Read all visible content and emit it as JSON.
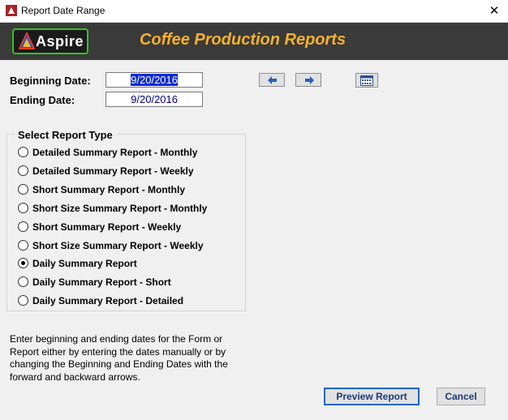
{
  "window": {
    "title": "Report Date Range",
    "close_glyph": "✕"
  },
  "banner": {
    "logo_text": "Aspire",
    "title": "Coffee Production Reports"
  },
  "dates": {
    "beginning_label": "Beginning Date:",
    "beginning_value": "9/20/2016",
    "ending_label": "Ending Date:",
    "ending_value": "9/20/2016"
  },
  "nav": {
    "back_icon": "arrow-left-icon",
    "forward_icon": "arrow-right-icon",
    "calendar_icon": "calendar-icon"
  },
  "report_type": {
    "group_title": "Select Report Type",
    "selected_index": 6,
    "options": [
      "Detailed Summary Report - Monthly",
      "Detailed Summary Report - Weekly",
      "Short Summary Report - Monthly",
      "Short Size Summary Report - Monthly",
      "Short Summary Report - Weekly",
      "Short Size Summary Report - Weekly",
      "Daily Summary Report",
      "Daily Summary Report - Short",
      "Daily Summary Report - Detailed"
    ]
  },
  "instructions": "Enter beginning and ending dates for the Form or Report either by entering the dates manually or by changing the Beginning and Ending Dates with the forward and backward arrows.",
  "buttons": {
    "preview": "Preview Report",
    "cancel": "Cancel"
  },
  "colors": {
    "banner_bg": "#3a3a3a",
    "banner_title": "#f6b22d",
    "logo_border": "#37c224",
    "selection": "#0a2bd6"
  }
}
